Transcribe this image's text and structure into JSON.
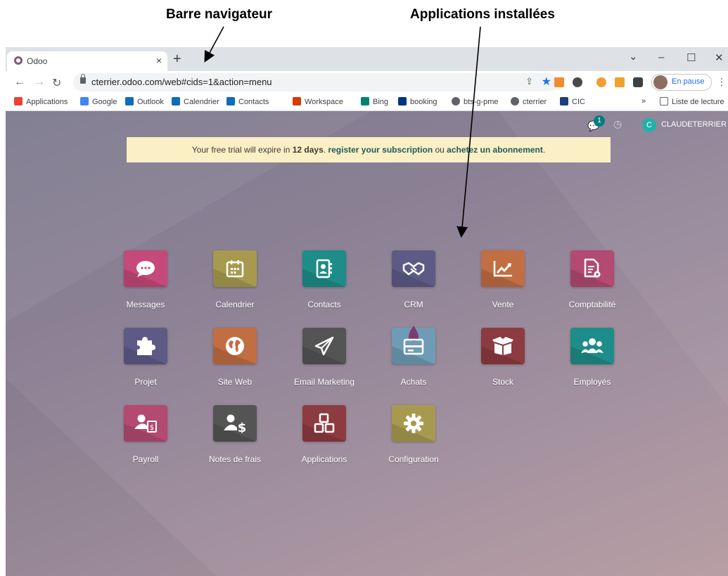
{
  "annotations": {
    "browser_bar": "Barre navigateur",
    "installed_apps": "Applications installées"
  },
  "browser": {
    "tab_title": "Odoo",
    "tab_close": "×",
    "new_tab": "+",
    "window_controls": {
      "minimize": "–",
      "maximize": "☐",
      "close": "✕",
      "tabsearch": "⌄"
    },
    "url": "cterrier.odoo.com/web#cids=1&action=menu",
    "profile_status": "En pause",
    "bookmarks": [
      {
        "label": "Applications",
        "icon": "apps-grid-icon",
        "color": "#ea4335"
      },
      {
        "label": "Google",
        "icon": "google-icon",
        "color": "#4285f4"
      },
      {
        "label": "Outlook",
        "icon": "outlook-icon",
        "color": "#0f6cbd"
      },
      {
        "label": "Calendrier",
        "icon": "calendar-icon",
        "color": "#0f6cbd"
      },
      {
        "label": "Contacts",
        "icon": "contacts-icon",
        "color": "#0f6cbd"
      },
      {
        "label": "Workspace",
        "icon": "workspace-icon",
        "color": "#d83b01"
      },
      {
        "label": "Bing",
        "icon": "bing-icon",
        "color": "#008373"
      },
      {
        "label": "booking",
        "icon": "booking-icon",
        "color": "#003580"
      },
      {
        "label": "bts-g-pme",
        "icon": "globe-icon",
        "color": "#5f6368"
      },
      {
        "label": "cterrier",
        "icon": "globe-icon",
        "color": "#5f6368"
      },
      {
        "label": "CIC",
        "icon": "cic-icon",
        "color": "#1d3f7a"
      }
    ],
    "bookmarks_more": "»",
    "reading_list": "Liste de lecture"
  },
  "odoo": {
    "chat_badge": "1",
    "user_initial": "C",
    "user_name": "CLAUDETERRIER",
    "trial": {
      "prefix": "Your free trial will expire in ",
      "days": "12 days",
      "dot": ". ",
      "register": "register your subscription",
      "ou": " ou ",
      "buy": "achetez un abonnement",
      "end": "."
    },
    "apps": [
      {
        "label": "Messages",
        "icon": "chat-bubble-icon",
        "color": "#c5497a"
      },
      {
        "label": "Calendrier",
        "icon": "calendar-icon",
        "color": "#a79a4e"
      },
      {
        "label": "Contacts",
        "icon": "address-book-icon",
        "color": "#1e8c88"
      },
      {
        "label": "CRM",
        "icon": "handshake-icon",
        "color": "#5d5b86"
      },
      {
        "label": "Vente",
        "icon": "line-chart-icon",
        "color": "#c16e43"
      },
      {
        "label": "Comptabilité",
        "icon": "invoice-gear-icon",
        "color": "#b24a72"
      },
      {
        "label": "Projet",
        "icon": "puzzle-icon",
        "color": "#5d5b86"
      },
      {
        "label": "Site Web",
        "icon": "globe-icon",
        "color": "#c16e43"
      },
      {
        "label": "Email Marketing",
        "icon": "paper-plane-icon",
        "color": "#555454"
      },
      {
        "label": "Achats",
        "icon": "purchase-card-icon",
        "color": "#6e9cb7"
      },
      {
        "label": "Stock",
        "icon": "box-icon",
        "color": "#8c3b40"
      },
      {
        "label": "Employés",
        "icon": "users-icon",
        "color": "#1e8c88"
      },
      {
        "label": "Payroll",
        "icon": "user-payslip-icon",
        "color": "#b24a72"
      },
      {
        "label": "Notes de frais",
        "icon": "user-dollar-icon",
        "color": "#555454"
      },
      {
        "label": "Applications",
        "icon": "cubes-icon",
        "color": "#8c3b40"
      },
      {
        "label": "Configuration",
        "icon": "gear-icon",
        "color": "#a79a4e"
      }
    ]
  }
}
